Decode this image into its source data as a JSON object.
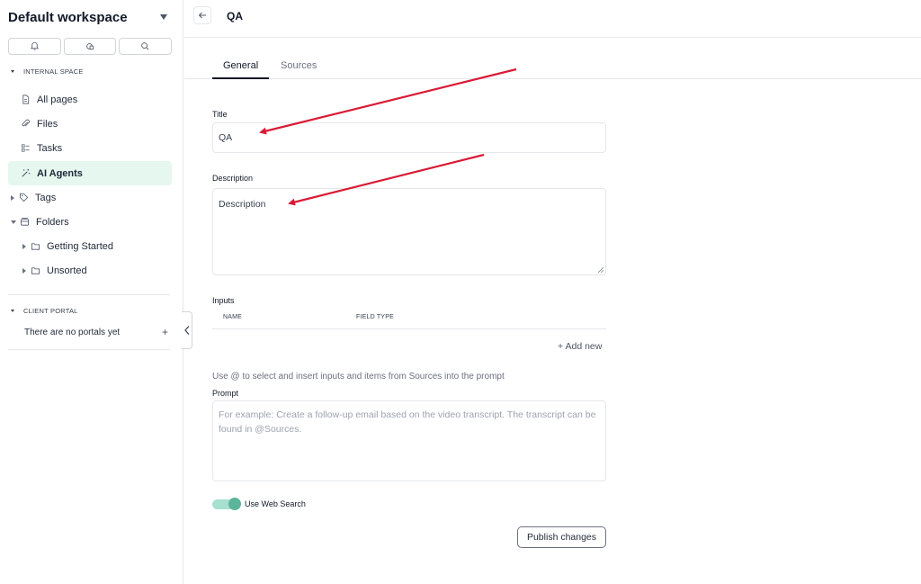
{
  "sidebar": {
    "workspace_title": "Default workspace",
    "quick_icons": [
      "bell-icon",
      "layers-icon",
      "search-icon"
    ],
    "internal_space_label": "INTERNAL SPACE",
    "items": [
      {
        "label": "All pages",
        "icon": "page-icon"
      },
      {
        "label": "Files",
        "icon": "paperclip-icon"
      },
      {
        "label": "Tasks",
        "icon": "tasks-icon"
      },
      {
        "label": "AI Agents",
        "icon": "magic-wand-icon",
        "active": true
      },
      {
        "label": "Tags",
        "icon": "tag-icon"
      },
      {
        "label": "Folders",
        "icon": "folders-icon"
      }
    ],
    "folders": [
      {
        "label": "Getting Started",
        "icon": "folder-icon"
      },
      {
        "label": "Unsorted",
        "icon": "folder-icon"
      }
    ],
    "client_portal_label": "CLIENT PORTAL",
    "no_portals_text": "There are no portals yet",
    "add_portal": "+"
  },
  "header": {
    "title": "QA"
  },
  "tabs": [
    {
      "label": "General",
      "active": true
    },
    {
      "label": "Sources",
      "active": false
    }
  ],
  "form": {
    "title_label": "Title",
    "title_value": "QA",
    "description_label": "Description",
    "description_value": "Description",
    "inputs_label": "Inputs",
    "columns": [
      "NAME",
      "FIELD TYPE"
    ],
    "add_new": "+ Add new",
    "prompt_hint": "Use @ to select and insert inputs and items from Sources into the prompt",
    "prompt_label": "Prompt",
    "prompt_placeholder": "For example: Create a follow-up email based on the video transcript. The transcript can be found in @Sources.",
    "web_search_label": "Use Web Search",
    "web_search_on": true,
    "publish_label": "Publish changes"
  },
  "colors": {
    "active_nav_bg": "#e6f7f0",
    "toggle_on": "#5bb59a",
    "annotation_arrow": "#d81b36"
  }
}
